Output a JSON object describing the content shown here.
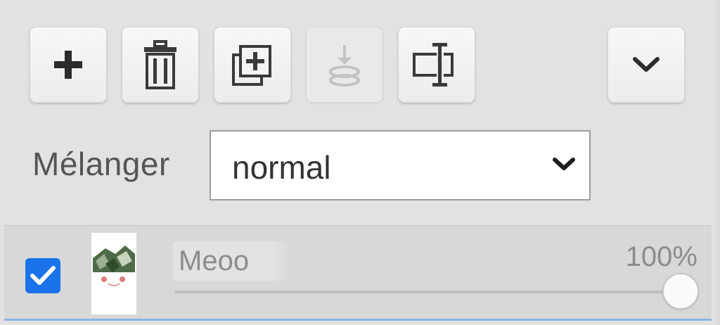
{
  "toolbar": {
    "buttons": [
      {
        "icon": "plus-icon",
        "enabled": true
      },
      {
        "icon": "trash-icon",
        "enabled": true
      },
      {
        "icon": "duplicate-icon",
        "enabled": true
      },
      {
        "icon": "merge-down-icon",
        "enabled": false
      },
      {
        "icon": "rename-icon",
        "enabled": true
      },
      {
        "icon": "chevron-down-icon",
        "enabled": true
      }
    ]
  },
  "blend": {
    "label": "Mélanger",
    "value": "normal"
  },
  "layer": {
    "visible": true,
    "name": "Meoo",
    "opacity_text": "100%",
    "opacity": 1.0
  },
  "colors": {
    "panel_bg": "#e2e2e2",
    "checkbox_accent": "#1a73e8",
    "selection_border": "#8ab0e3"
  }
}
